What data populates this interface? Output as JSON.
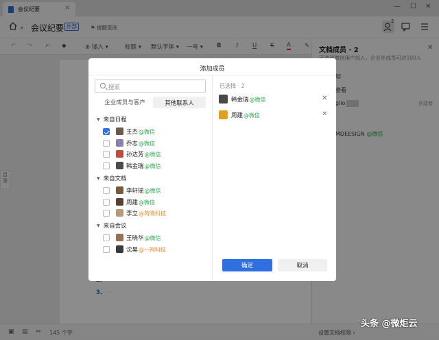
{
  "tab": {
    "title": "会议纪要"
  },
  "header": {
    "title": "会议纪要",
    "badge": "外部",
    "remind": "提醒查阅",
    "members_count_badge": "2"
  },
  "toolbar": {
    "insert": "插入",
    "heading": "标题",
    "font": "默认字体",
    "size": "一号",
    "bold": "B",
    "italic": "I",
    "underline": "U",
    "strike": "S",
    "color": "A"
  },
  "outline_tab": "目录",
  "doc": {
    "list_items": [
      "2、",
      "3、"
    ],
    "list_fade": "..."
  },
  "right_panel": {
    "title": "文档成员 · 2",
    "subtitle": "可邀请微信用户加入，企业外成员可达100人",
    "rows": [
      "加",
      "查看",
      "glio",
      "创建者",
      "MDEESIGN",
      "@微信"
    ],
    "footer": "设置文档权限"
  },
  "status": {
    "word_count": "145 个字"
  },
  "modal": {
    "title": "添加成员",
    "search_placeholder": "搜索",
    "tab_internal": "企业成员与客户",
    "tab_other": "其他联系人",
    "groups": [
      {
        "label": "来自日程",
        "items": [
          {
            "name": "王杰",
            "org": "@微信",
            "org_color": "#2ea84f",
            "checked": true,
            "avatar": "#6b5a4a"
          },
          {
            "name": "乔志",
            "org": "@微信",
            "org_color": "#2ea84f",
            "checked": false,
            "avatar": "#8a7fb0"
          },
          {
            "name": "孙达芳",
            "org": "@微信",
            "org_color": "#2ea84f",
            "checked": false,
            "avatar": "#c24a3a"
          },
          {
            "name": "韩金瑞",
            "org": "@微信",
            "org_color": "#2ea84f",
            "checked": false,
            "avatar": "#4a4a4a"
          }
        ]
      },
      {
        "label": "来自文档",
        "items": [
          {
            "name": "李轩瑶",
            "org": "@微信",
            "org_color": "#2ea84f",
            "checked": false,
            "avatar": "#7a5a3a"
          },
          {
            "name": "周建",
            "org": "@微信",
            "org_color": "#2ea84f",
            "checked": false,
            "avatar": "#5a4030"
          },
          {
            "name": "李立",
            "org": "@芮晓科技",
            "org_color": "#f08a24",
            "checked": false,
            "avatar": "#b89a7a"
          }
        ]
      },
      {
        "label": "来自会议",
        "items": [
          {
            "name": "王晓华",
            "org": "@微信",
            "org_color": "#2ea84f",
            "checked": false,
            "avatar": "#9a7050"
          },
          {
            "name": "沈昊",
            "org": "@一祠科技",
            "org_color": "#f08a24",
            "checked": false,
            "avatar": "#3a3a3a"
          }
        ]
      }
    ],
    "selected_header": "已选择 · 2",
    "selected": [
      {
        "name": "韩金瑞",
        "org": "@微信",
        "avatar": "#4a4a4a"
      },
      {
        "name": "周建",
        "org": "@微信",
        "avatar": "#e0a020"
      }
    ],
    "ok": "确定",
    "cancel": "取消"
  },
  "watermark": "头条 @微炬云"
}
